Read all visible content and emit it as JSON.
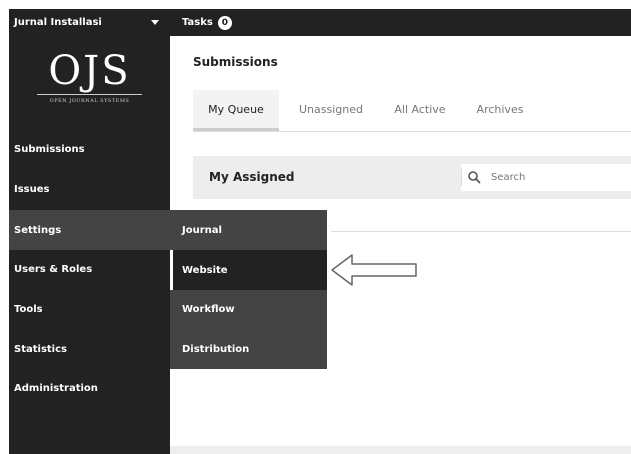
{
  "topbar": {
    "journal_name": "Jurnal Installasi",
    "tasks_label": "Tasks",
    "tasks_count": "0"
  },
  "logo": {
    "mark": "OJS",
    "subtitle": "OPEN JOURNAL SYSTEMS"
  },
  "sidebar": {
    "items": [
      {
        "label": "Submissions"
      },
      {
        "label": "Issues"
      },
      {
        "label": "Settings",
        "active": true
      },
      {
        "label": "Users & Roles"
      },
      {
        "label": "Tools"
      },
      {
        "label": "Statistics"
      },
      {
        "label": "Administration"
      }
    ]
  },
  "submenu": {
    "items": [
      {
        "label": "Journal"
      },
      {
        "label": "Website",
        "active": true
      },
      {
        "label": "Workflow"
      },
      {
        "label": "Distribution"
      }
    ]
  },
  "main": {
    "page_title": "Submissions",
    "tabs": [
      {
        "label": "My Queue",
        "active": true
      },
      {
        "label": "Unassigned"
      },
      {
        "label": "All Active"
      },
      {
        "label": "Archives"
      }
    ],
    "grid_title": "My Assigned",
    "search_placeholder": "Search"
  },
  "colors": {
    "sidebar_bg": "#222222",
    "submenu_bg": "#444444",
    "grid_header_bg": "#ededed"
  }
}
